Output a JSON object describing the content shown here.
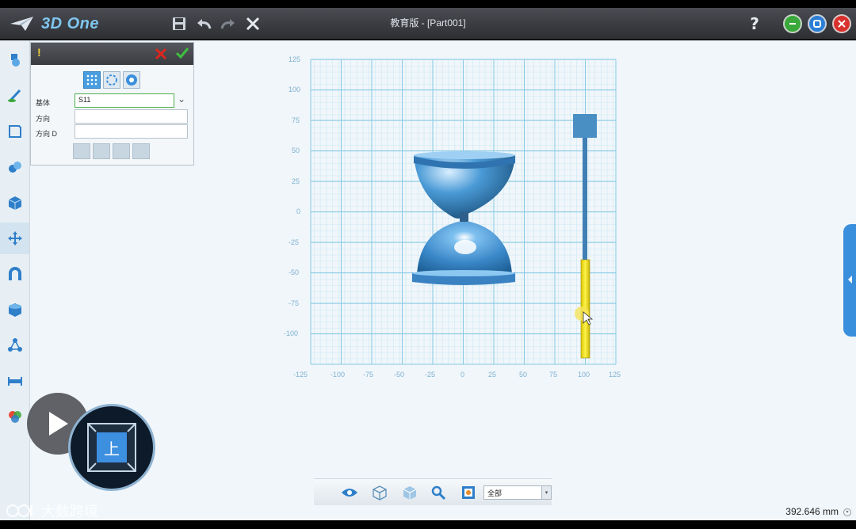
{
  "app": {
    "logo_text": "3D One",
    "window_title": "教育版 - [Part001]",
    "help_label": "?"
  },
  "toolbar": [
    "save-icon",
    "undo-icon",
    "redo-icon",
    "delete-icon"
  ],
  "left_toolbar": [
    "sketch-shapes-icon",
    "sketch-draw-icon",
    "edit-sketch-icon",
    "special-features-icon",
    "basic-editing-icon",
    "move-icon",
    "combine-icon",
    "fillet-icon",
    "array-icon",
    "distance-measure-icon",
    "color-icon"
  ],
  "panel": {
    "warn_label": "!",
    "fields": [
      {
        "label": "基体",
        "value": "S11"
      },
      {
        "label": "方向",
        "value": ""
      },
      {
        "label": "方向 D",
        "value": ""
      }
    ],
    "dropdown_arrow": "⌄"
  },
  "grid": {
    "x_ticks": [
      "-125",
      "-100",
      "-75",
      "-50",
      "-25",
      "0",
      "25",
      "50",
      "75",
      "100",
      "125"
    ],
    "y_ticks": [
      "125",
      "100",
      "75",
      "50",
      "25",
      "0",
      "-25",
      "-50",
      "-75",
      "-100"
    ]
  },
  "viewcube": {
    "face_label": "上"
  },
  "bottom_tools": {
    "filter_value": "全部",
    "filter_arrow": "▾"
  },
  "status": {
    "measurement": "392.646 mm"
  },
  "watermark": {
    "text": "大数跨境"
  }
}
